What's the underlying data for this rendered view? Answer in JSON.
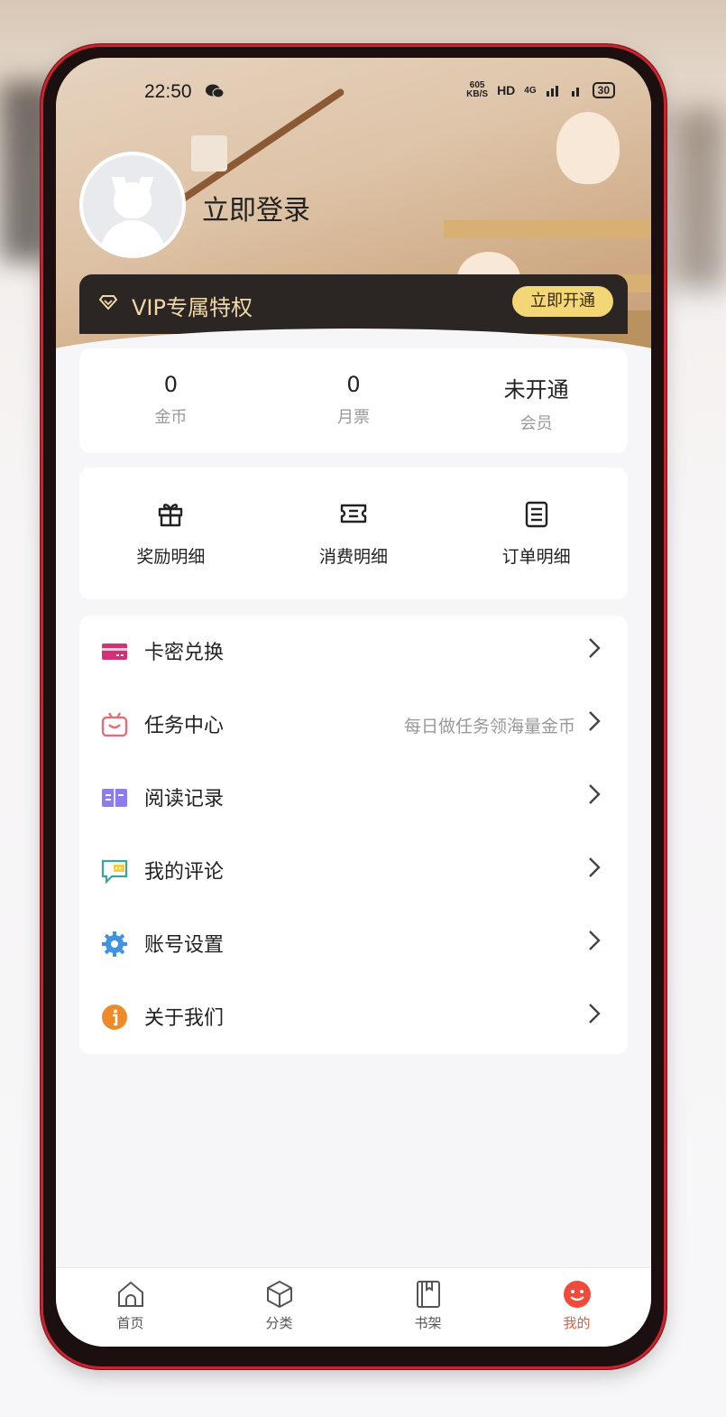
{
  "status_bar": {
    "time": "22:50",
    "speed_top": "605",
    "speed_bottom": "KB/S",
    "hd": "HD",
    "network": "4G",
    "battery": "30"
  },
  "profile": {
    "login_label": "立即登录"
  },
  "vip": {
    "label": "VIP专属特权",
    "button": "立即开通"
  },
  "stats": [
    {
      "value": "0",
      "label": "金币"
    },
    {
      "value": "0",
      "label": "月票"
    },
    {
      "value": "未开通",
      "label": "会员"
    }
  ],
  "actions": [
    {
      "label": "奖励明细",
      "icon": "gift-icon"
    },
    {
      "label": "消费明细",
      "icon": "ticket-icon"
    },
    {
      "label": "订单明细",
      "icon": "order-list-icon"
    }
  ],
  "menu": [
    {
      "label": "卡密兑换",
      "hint": "",
      "icon": "card-icon",
      "color": "#d4307a"
    },
    {
      "label": "任务中心",
      "hint": "每日做任务领海量金币",
      "icon": "task-icon",
      "color": "#e0707a"
    },
    {
      "label": "阅读记录",
      "hint": "",
      "icon": "book-icon",
      "color": "#8b7cf0"
    },
    {
      "label": "我的评论",
      "hint": "",
      "icon": "comment-icon",
      "color": "#3aa59a"
    },
    {
      "label": "账号设置",
      "hint": "",
      "icon": "gear-icon",
      "color": "#3f93e0"
    },
    {
      "label": "关于我们",
      "hint": "",
      "icon": "info-icon",
      "color": "#ee8a2a"
    }
  ],
  "tabs": [
    {
      "label": "首页",
      "icon": "home-icon",
      "active": false
    },
    {
      "label": "分类",
      "icon": "cube-icon",
      "active": false
    },
    {
      "label": "书架",
      "icon": "bookshelf-icon",
      "active": false
    },
    {
      "label": "我的",
      "icon": "smiley-icon",
      "active": true
    }
  ],
  "colors": {
    "accent": "#e65a3c",
    "vip_bar": "#2b2523",
    "vip_button": "#f3d776",
    "frame": "#c8232f"
  }
}
